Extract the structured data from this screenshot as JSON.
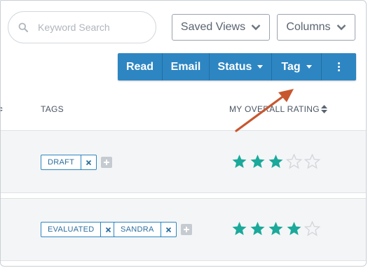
{
  "search": {
    "placeholder": "Keyword Search",
    "value": ""
  },
  "header_buttons": {
    "saved_views": "Saved Views",
    "columns": "Columns"
  },
  "toolbar": {
    "read": "Read",
    "email": "Email",
    "status": "Status",
    "tag": "Tag"
  },
  "columns": {
    "tags": "TAGS",
    "rating": "MY OVERALL RATING"
  },
  "rows": [
    {
      "tags": [
        {
          "label": "DRAFT"
        }
      ],
      "rating": 3,
      "max_rating": 5
    },
    {
      "tags": [
        {
          "label": "EVALUATED"
        },
        {
          "label": "SANDRA"
        }
      ],
      "rating": 4,
      "max_rating": 5
    }
  ],
  "colors": {
    "accent": "#2d86c2",
    "star_filled": "#1aa99a",
    "star_empty": "#d2d7dc",
    "annotation_arrow": "#c8572f"
  },
  "icons": {
    "search": "search-icon",
    "dropdown": "chevron-down-icon",
    "more": "more-vertical-icon",
    "remove_tag": "close-icon",
    "add_tag": "plus-icon",
    "rating": "star-icon",
    "sort": "sort-icon"
  }
}
